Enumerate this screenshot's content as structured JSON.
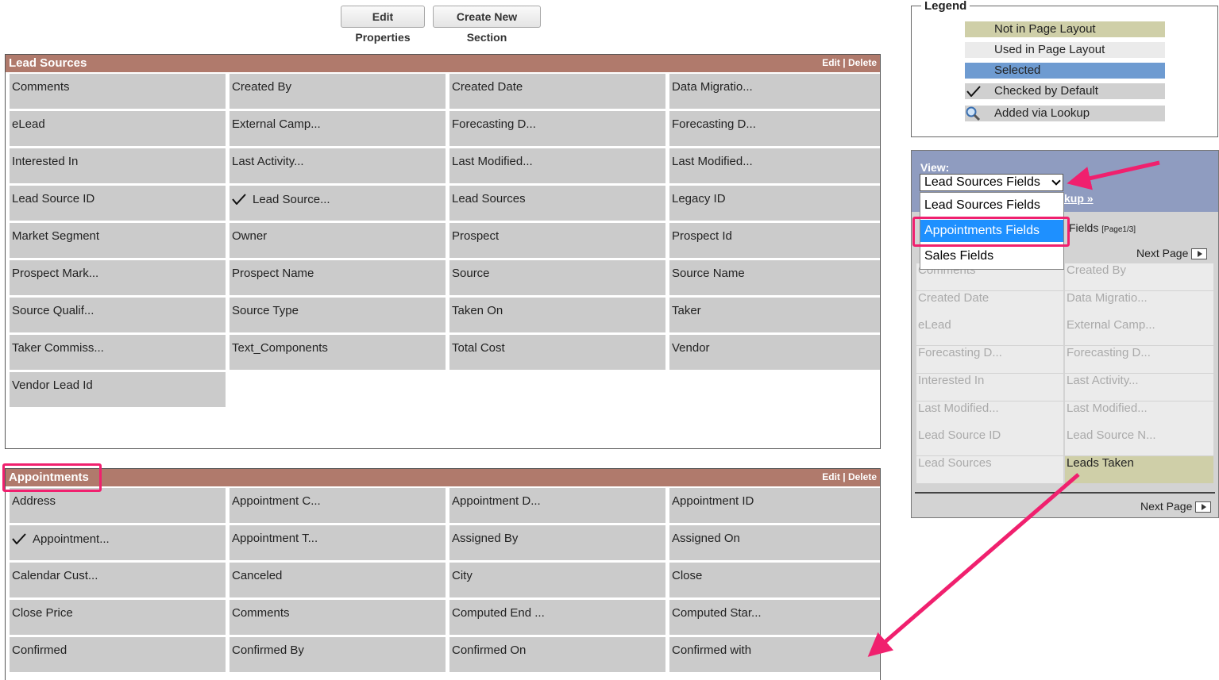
{
  "toolbar": {
    "edit_properties_label": "Edit Properties",
    "create_new_section_label": "Create New Section"
  },
  "sections": [
    {
      "title": "Lead Sources",
      "edit_label": "Edit",
      "separator": "|",
      "delete_label": "Delete",
      "fields": [
        {
          "label": "Comments"
        },
        {
          "label": "Created By"
        },
        {
          "label": "Created Date"
        },
        {
          "label": "Data Migratio..."
        },
        {
          "label": "eLead"
        },
        {
          "label": "External Camp..."
        },
        {
          "label": "Forecasting D..."
        },
        {
          "label": "Forecasting D..."
        },
        {
          "label": "Interested In"
        },
        {
          "label": "Last Activity..."
        },
        {
          "label": "Last Modified..."
        },
        {
          "label": "Last Modified..."
        },
        {
          "label": "Lead Source ID"
        },
        {
          "label": "Lead Source...",
          "checked": true
        },
        {
          "label": "Lead Sources"
        },
        {
          "label": "Legacy ID"
        },
        {
          "label": "Market Segment"
        },
        {
          "label": "Owner"
        },
        {
          "label": "Prospect"
        },
        {
          "label": "Prospect Id"
        },
        {
          "label": "Prospect Mark..."
        },
        {
          "label": "Prospect Name"
        },
        {
          "label": "Source"
        },
        {
          "label": "Source Name"
        },
        {
          "label": "Source Qualif..."
        },
        {
          "label": "Source Type"
        },
        {
          "label": "Taken On"
        },
        {
          "label": "Taker"
        },
        {
          "label": "Taker Commiss..."
        },
        {
          "label": "Text_Components"
        },
        {
          "label": "Total Cost"
        },
        {
          "label": "Vendor"
        },
        {
          "label": "Vendor Lead Id"
        }
      ]
    },
    {
      "title": "Appointments",
      "edit_label": "Edit",
      "separator": "|",
      "delete_label": "Delete",
      "fields": [
        {
          "label": "Address"
        },
        {
          "label": "Appointment C..."
        },
        {
          "label": "Appointment D..."
        },
        {
          "label": "Appointment ID"
        },
        {
          "label": "Appointment...",
          "checked": true
        },
        {
          "label": "Appointment T..."
        },
        {
          "label": "Assigned By"
        },
        {
          "label": "Assigned On"
        },
        {
          "label": "Calendar Cust..."
        },
        {
          "label": "Canceled"
        },
        {
          "label": "City"
        },
        {
          "label": "Close"
        },
        {
          "label": "Close Price"
        },
        {
          "label": "Comments"
        },
        {
          "label": "Computed End ..."
        },
        {
          "label": "Computed Star..."
        },
        {
          "label": "Confirmed"
        },
        {
          "label": "Confirmed By"
        },
        {
          "label": "Confirmed On"
        },
        {
          "label": "Confirmed with"
        }
      ]
    }
  ],
  "legend": {
    "title": "Legend",
    "items": [
      {
        "label": "Not in Page Layout",
        "color": "#cfcfa8",
        "icon": ""
      },
      {
        "label": "Used in Page Layout",
        "color": "#ebebeb",
        "icon": ""
      },
      {
        "label": "Selected",
        "color": "#6e9bd1",
        "icon": ""
      },
      {
        "label": "Checked by Default",
        "color": "#d0d0d0",
        "icon": "checkmark-icon"
      },
      {
        "label": "Added via Lookup",
        "color": "#d0d0d0",
        "icon": "magnifier-icon"
      }
    ]
  },
  "field_panel": {
    "view_label": "View:",
    "selected_view": "Lead Sources Fields",
    "lookup_link": "kup »",
    "fields_title": "Fields",
    "page_indicator": "[Page1/3]",
    "next_page_label": "Next Page",
    "dropdown_options": [
      {
        "label": "Lead Sources Fields",
        "highlighted": false
      },
      {
        "label": "Appointments Fields",
        "highlighted": true
      },
      {
        "label": "Sales Fields",
        "highlighted": false
      }
    ],
    "fields": [
      {
        "label": "Comments"
      },
      {
        "label": "Created By"
      },
      {
        "label": "Created Date"
      },
      {
        "label": "Data Migratio..."
      },
      {
        "label": "eLead"
      },
      {
        "label": "External Camp..."
      },
      {
        "label": "Forecasting D..."
      },
      {
        "label": "Forecasting D..."
      },
      {
        "label": "Interested In"
      },
      {
        "label": "Last Activity..."
      },
      {
        "label": "Last Modified..."
      },
      {
        "label": "Last Modified..."
      },
      {
        "label": "Lead Source ID"
      },
      {
        "label": "Lead Source N..."
      },
      {
        "label": "Lead Sources"
      },
      {
        "label": "Leads Taken",
        "available": true
      }
    ]
  },
  "colors": {
    "section_header": "#b07a6c",
    "cell_bg": "#cbcbcb",
    "annotation": "#f0206e",
    "available_field": "#cfcfa8",
    "dropdown_highlight": "#1e90ff"
  }
}
